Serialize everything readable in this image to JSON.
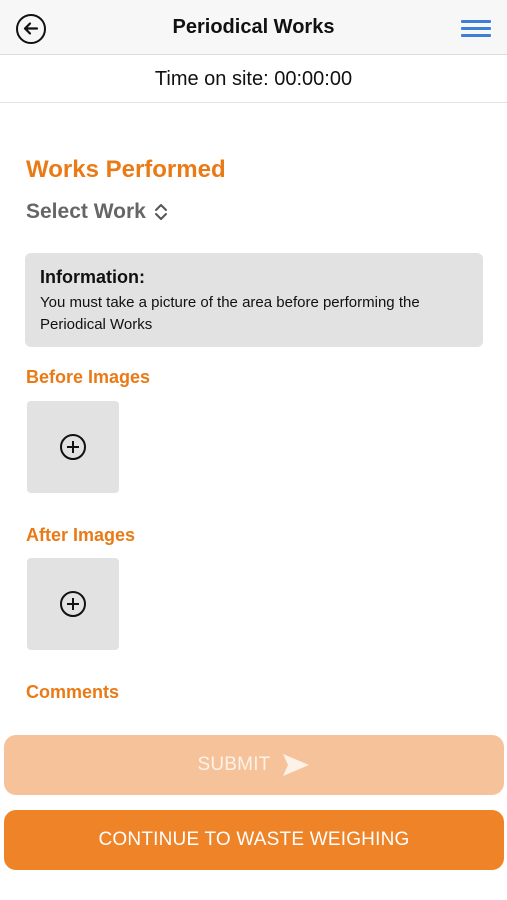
{
  "header": {
    "title": "Periodical Works",
    "back_icon": "back-arrow-circle-icon",
    "menu_icon": "hamburger-menu-icon",
    "menu_color": "#3b7fd6"
  },
  "timer": {
    "text": "Time on site: 00:00:00"
  },
  "works": {
    "title": "Works Performed",
    "select_label": "Select Work",
    "select_icon": "chevron-up-down-icon"
  },
  "info": {
    "title": "Information:",
    "text": "You must take a picture of the area before performing the Periodical Works"
  },
  "before_images": {
    "label": "Before Images",
    "add_icon": "add-circle-icon"
  },
  "after_images": {
    "label": "After Images",
    "add_icon": "add-circle-icon"
  },
  "comments": {
    "label": "Comments"
  },
  "actions": {
    "submit_label": "SUBMIT",
    "submit_icon": "send-icon",
    "continue_label": "CONTINUE TO WASTE WEIGHING"
  },
  "colors": {
    "accent": "#e97a16",
    "primary_button": "#ee8328",
    "disabled_button": "#f6c29a"
  }
}
